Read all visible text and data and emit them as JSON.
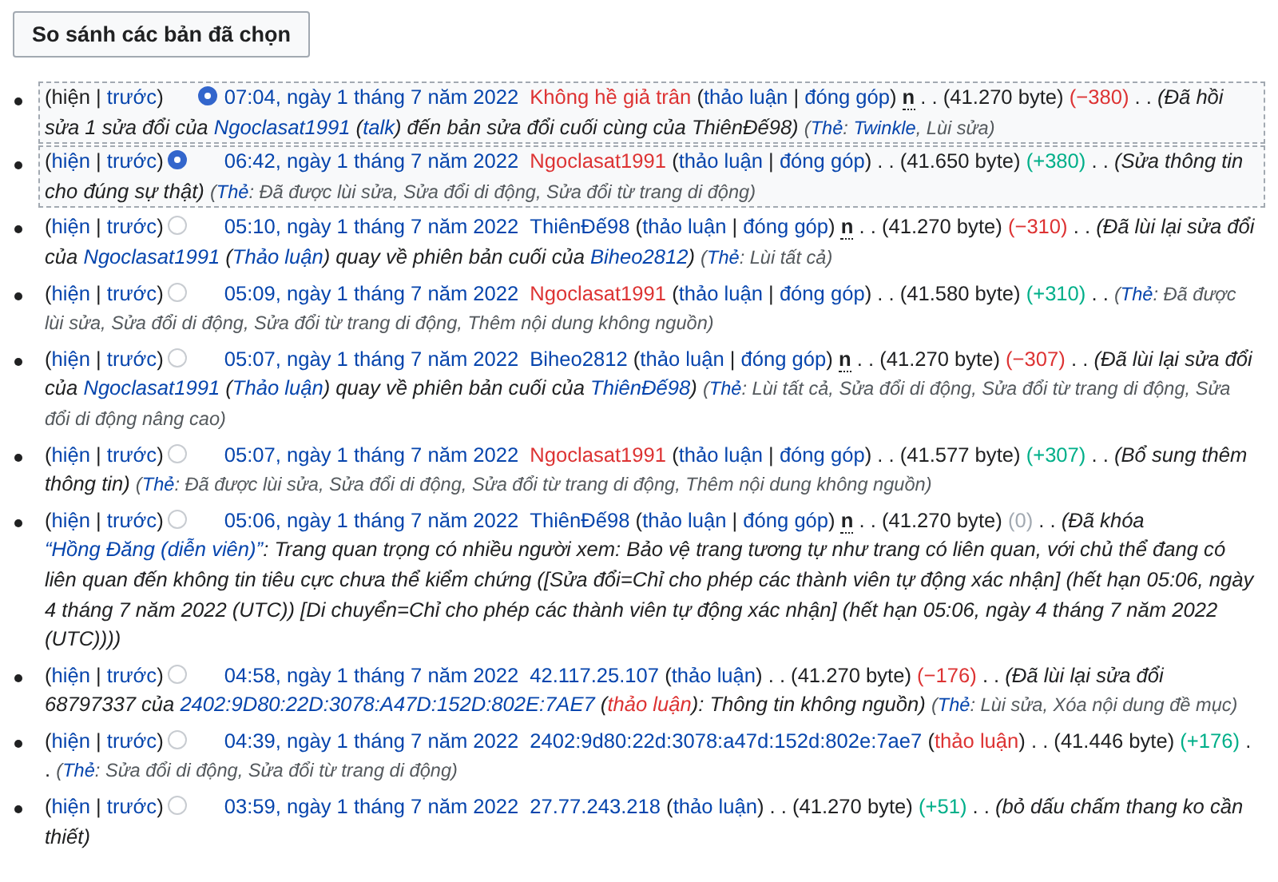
{
  "compare_button": "So sánh các bản đã chọn",
  "entries": [
    {
      "radio": {
        "kind": "diff",
        "selected": true
      },
      "head": [
        {
          "kind": "text",
          "text": "(hiện | "
        },
        {
          "kind": "link",
          "text": "trước"
        },
        {
          "kind": "text",
          "text": ")"
        }
      ],
      "body": [
        {
          "kind": "time",
          "text": "07:04, ngày 1 tháng 7 năm 2022"
        },
        {
          "kind": "red",
          "text": "Không hề giả trân"
        },
        {
          "kind": "text",
          "text": " ("
        },
        {
          "kind": "link",
          "text": "thảo luận"
        },
        {
          "kind": "text",
          "text": " | "
        },
        {
          "kind": "link",
          "text": "đóng góp"
        },
        {
          "kind": "text",
          "text": ") "
        },
        {
          "kind": "minor",
          "text": "n"
        },
        {
          "kind": "text",
          "text": " . . (41.270 byte) "
        },
        {
          "kind": "neg",
          "text": "(−380)"
        },
        {
          "kind": "text",
          "text": " . . "
        },
        {
          "kind": "sum",
          "text": "(Đã hồi sửa 1 sửa đổi của "
        },
        {
          "kind": "sumlink",
          "text": "Ngoclasat1991"
        },
        {
          "kind": "sum",
          "text": " ("
        },
        {
          "kind": "sumlink",
          "text": "talk"
        },
        {
          "kind": "sum",
          "text": ") đến bản sửa đổi cuối cùng của ThiênĐế98) "
        },
        {
          "kind": "tag",
          "text": "("
        },
        {
          "kind": "taglink",
          "text": "Thẻ"
        },
        {
          "kind": "tag",
          "text": ": "
        },
        {
          "kind": "taglink",
          "text": "Twinkle"
        },
        {
          "kind": "tag",
          "text": ", Lùi sửa)"
        }
      ]
    },
    {
      "radio": {
        "kind": "oldid",
        "selected": true
      },
      "head": [
        {
          "kind": "text",
          "text": "("
        },
        {
          "kind": "link",
          "text": "hiện"
        },
        {
          "kind": "text",
          "text": " | "
        },
        {
          "kind": "link",
          "text": "trước"
        },
        {
          "kind": "text",
          "text": ")"
        }
      ],
      "body": [
        {
          "kind": "time",
          "text": "06:42, ngày 1 tháng 7 năm 2022"
        },
        {
          "kind": "red",
          "text": "Ngoclasat1991"
        },
        {
          "kind": "text",
          "text": " ("
        },
        {
          "kind": "link",
          "text": "thảo luận"
        },
        {
          "kind": "text",
          "text": " | "
        },
        {
          "kind": "link",
          "text": "đóng góp"
        },
        {
          "kind": "text",
          "text": ") . . (41.650 byte) "
        },
        {
          "kind": "pos",
          "text": "(+380)"
        },
        {
          "kind": "text",
          "text": " . . "
        },
        {
          "kind": "sum",
          "text": "(Sửa thông tin cho đúng sự thật) "
        },
        {
          "kind": "tag",
          "text": "("
        },
        {
          "kind": "taglink",
          "text": "Thẻ"
        },
        {
          "kind": "tag",
          "text": ": Đã được lùi sửa, Sửa đổi di động, Sửa đổi từ trang di động)"
        }
      ]
    },
    {
      "radio": {
        "kind": "oldid",
        "selected": false
      },
      "head": [
        {
          "kind": "text",
          "text": "("
        },
        {
          "kind": "link",
          "text": "hiện"
        },
        {
          "kind": "text",
          "text": " | "
        },
        {
          "kind": "link",
          "text": "trước"
        },
        {
          "kind": "text",
          "text": ")"
        }
      ],
      "body": [
        {
          "kind": "time",
          "text": "05:10, ngày 1 tháng 7 năm 2022"
        },
        {
          "kind": "link",
          "text": "ThiênĐế98"
        },
        {
          "kind": "text",
          "text": " ("
        },
        {
          "kind": "link",
          "text": "thảo luận"
        },
        {
          "kind": "text",
          "text": " | "
        },
        {
          "kind": "link",
          "text": "đóng góp"
        },
        {
          "kind": "text",
          "text": ") "
        },
        {
          "kind": "minor",
          "text": "n"
        },
        {
          "kind": "text",
          "text": " . . (41.270 byte) "
        },
        {
          "kind": "neg",
          "text": "(−310)"
        },
        {
          "kind": "text",
          "text": " . . "
        },
        {
          "kind": "sum",
          "text": "(Đã lùi lại sửa đổi của "
        },
        {
          "kind": "sumlink",
          "text": "Ngoclasat1991"
        },
        {
          "kind": "sum",
          "text": " ("
        },
        {
          "kind": "sumlink",
          "text": "Thảo luận"
        },
        {
          "kind": "sum",
          "text": ") quay về phiên bản cuối của "
        },
        {
          "kind": "sumlink",
          "text": "Biheo2812"
        },
        {
          "kind": "sum",
          "text": ") "
        },
        {
          "kind": "tag",
          "text": "("
        },
        {
          "kind": "taglink",
          "text": "Thẻ"
        },
        {
          "kind": "tag",
          "text": ": Lùi tất cả)"
        }
      ]
    },
    {
      "radio": {
        "kind": "oldid",
        "selected": false
      },
      "head": [
        {
          "kind": "text",
          "text": "("
        },
        {
          "kind": "link",
          "text": "hiện"
        },
        {
          "kind": "text",
          "text": " | "
        },
        {
          "kind": "link",
          "text": "trước"
        },
        {
          "kind": "text",
          "text": ")"
        }
      ],
      "body": [
        {
          "kind": "time",
          "text": "05:09, ngày 1 tháng 7 năm 2022"
        },
        {
          "kind": "red",
          "text": "Ngoclasat1991"
        },
        {
          "kind": "text",
          "text": " ("
        },
        {
          "kind": "link",
          "text": "thảo luận"
        },
        {
          "kind": "text",
          "text": " | "
        },
        {
          "kind": "link",
          "text": "đóng góp"
        },
        {
          "kind": "text",
          "text": ") . . (41.580 byte) "
        },
        {
          "kind": "pos",
          "text": "(+310)"
        },
        {
          "kind": "text",
          "text": " . . "
        },
        {
          "kind": "tag",
          "text": "("
        },
        {
          "kind": "taglink",
          "text": "Thẻ"
        },
        {
          "kind": "tag",
          "text": ": Đã được lùi sửa, Sửa đổi di động, Sửa đổi từ trang di động, Thêm nội dung không nguồn)"
        }
      ]
    },
    {
      "radio": {
        "kind": "oldid",
        "selected": false
      },
      "head": [
        {
          "kind": "text",
          "text": "("
        },
        {
          "kind": "link",
          "text": "hiện"
        },
        {
          "kind": "text",
          "text": " | "
        },
        {
          "kind": "link",
          "text": "trước"
        },
        {
          "kind": "text",
          "text": ")"
        }
      ],
      "body": [
        {
          "kind": "time",
          "text": "05:07, ngày 1 tháng 7 năm 2022"
        },
        {
          "kind": "link",
          "text": "Biheo2812"
        },
        {
          "kind": "text",
          "text": " ("
        },
        {
          "kind": "link",
          "text": "thảo luận"
        },
        {
          "kind": "text",
          "text": " | "
        },
        {
          "kind": "link",
          "text": "đóng góp"
        },
        {
          "kind": "text",
          "text": ") "
        },
        {
          "kind": "minor",
          "text": "n"
        },
        {
          "kind": "text",
          "text": " . . (41.270 byte) "
        },
        {
          "kind": "neg",
          "text": "(−307)"
        },
        {
          "kind": "text",
          "text": " . . "
        },
        {
          "kind": "sum",
          "text": "(Đã lùi lại sửa đổi của "
        },
        {
          "kind": "sumlink",
          "text": "Ngoclasat1991"
        },
        {
          "kind": "sum",
          "text": " ("
        },
        {
          "kind": "sumlink",
          "text": "Thảo luận"
        },
        {
          "kind": "sum",
          "text": ") quay về phiên bản cuối của "
        },
        {
          "kind": "sumlink",
          "text": "ThiênĐế98"
        },
        {
          "kind": "sum",
          "text": ") "
        },
        {
          "kind": "tag",
          "text": "("
        },
        {
          "kind": "taglink",
          "text": "Thẻ"
        },
        {
          "kind": "tag",
          "text": ": Lùi tất cả, Sửa đổi di động, Sửa đổi từ trang di động, Sửa đổi di động nâng cao)"
        }
      ]
    },
    {
      "radio": {
        "kind": "oldid",
        "selected": false
      },
      "head": [
        {
          "kind": "text",
          "text": "("
        },
        {
          "kind": "link",
          "text": "hiện"
        },
        {
          "kind": "text",
          "text": " | "
        },
        {
          "kind": "link",
          "text": "trước"
        },
        {
          "kind": "text",
          "text": ")"
        }
      ],
      "body": [
        {
          "kind": "time",
          "text": "05:07, ngày 1 tháng 7 năm 2022"
        },
        {
          "kind": "red",
          "text": "Ngoclasat1991"
        },
        {
          "kind": "text",
          "text": " ("
        },
        {
          "kind": "link",
          "text": "thảo luận"
        },
        {
          "kind": "text",
          "text": " | "
        },
        {
          "kind": "link",
          "text": "đóng góp"
        },
        {
          "kind": "text",
          "text": ") . . (41.577 byte) "
        },
        {
          "kind": "pos",
          "text": "(+307)"
        },
        {
          "kind": "text",
          "text": " . . "
        },
        {
          "kind": "sum",
          "text": "(Bổ sung thêm thông tin) "
        },
        {
          "kind": "tag",
          "text": "("
        },
        {
          "kind": "taglink",
          "text": "Thẻ"
        },
        {
          "kind": "tag",
          "text": ": Đã được lùi sửa, Sửa đổi di động, Sửa đổi từ trang di động, Thêm nội dung không nguồn)"
        }
      ]
    },
    {
      "radio": {
        "kind": "oldid",
        "selected": false
      },
      "head": [
        {
          "kind": "text",
          "text": "("
        },
        {
          "kind": "link",
          "text": "hiện"
        },
        {
          "kind": "text",
          "text": " | "
        },
        {
          "kind": "link",
          "text": "trước"
        },
        {
          "kind": "text",
          "text": ")"
        }
      ],
      "body": [
        {
          "kind": "time",
          "text": "05:06, ngày 1 tháng 7 năm 2022"
        },
        {
          "kind": "link",
          "text": "ThiênĐế98"
        },
        {
          "kind": "text",
          "text": " ("
        },
        {
          "kind": "link",
          "text": "thảo luận"
        },
        {
          "kind": "text",
          "text": " | "
        },
        {
          "kind": "link",
          "text": "đóng góp"
        },
        {
          "kind": "text",
          "text": ") "
        },
        {
          "kind": "minor",
          "text": "n"
        },
        {
          "kind": "text",
          "text": " . . (41.270 byte) "
        },
        {
          "kind": "zero",
          "text": "(0)"
        },
        {
          "kind": "text",
          "text": " . . "
        },
        {
          "kind": "sum",
          "text": "(Đã khóa "
        },
        {
          "kind": "sumlink",
          "text": "“Hồng Đăng (diễn viên)”"
        },
        {
          "kind": "sum",
          "text": ": Trang quan trọng có nhiều người xem: Bảo vệ trang tương tự như trang có liên quan, với chủ thể đang có liên quan đến không tin tiêu cực chưa thể kiểm chứng ([Sửa đổi=Chỉ cho phép các thành viên tự động xác nhận] (hết hạn 05:06, ngày 4 tháng 7 năm 2022 (UTC)) [Di chuyển=Chỉ cho phép các thành viên tự động xác nhận] (hết hạn 05:06, ngày 4 tháng 7 năm 2022 (UTC))))"
        }
      ]
    },
    {
      "radio": {
        "kind": "oldid",
        "selected": false
      },
      "head": [
        {
          "kind": "text",
          "text": "("
        },
        {
          "kind": "link",
          "text": "hiện"
        },
        {
          "kind": "text",
          "text": " | "
        },
        {
          "kind": "link",
          "text": "trước"
        },
        {
          "kind": "text",
          "text": ")"
        }
      ],
      "body": [
        {
          "kind": "time",
          "text": "04:58, ngày 1 tháng 7 năm 2022"
        },
        {
          "kind": "link",
          "text": "42.117.25.107"
        },
        {
          "kind": "text",
          "text": " ("
        },
        {
          "kind": "link",
          "text": "thảo luận"
        },
        {
          "kind": "text",
          "text": ") . . (41.270 byte) "
        },
        {
          "kind": "neg",
          "text": "(−176)"
        },
        {
          "kind": "text",
          "text": " . . "
        },
        {
          "kind": "sum",
          "text": "(Đã lùi lại sửa đổi 68797337 của "
        },
        {
          "kind": "sumlink",
          "text": "2402:9D80:22D:3078:A47D:152D:802E:7AE7"
        },
        {
          "kind": "sum",
          "text": " ("
        },
        {
          "kind": "sumred",
          "text": "thảo luận"
        },
        {
          "kind": "sum",
          "text": "): Thông tin không nguồn) "
        },
        {
          "kind": "tag",
          "text": "("
        },
        {
          "kind": "taglink",
          "text": "Thẻ"
        },
        {
          "kind": "tag",
          "text": ": Lùi sửa, Xóa nội dung đề mục)"
        }
      ]
    },
    {
      "radio": {
        "kind": "oldid",
        "selected": false
      },
      "head": [
        {
          "kind": "text",
          "text": "("
        },
        {
          "kind": "link",
          "text": "hiện"
        },
        {
          "kind": "text",
          "text": " | "
        },
        {
          "kind": "link",
          "text": "trước"
        },
        {
          "kind": "text",
          "text": ")"
        }
      ],
      "body": [
        {
          "kind": "time",
          "text": "04:39, ngày 1 tháng 7 năm 2022"
        },
        {
          "kind": "link",
          "text": "2402:9d80:22d:3078:a47d:152d:802e:7ae7"
        },
        {
          "kind": "text",
          "text": " ("
        },
        {
          "kind": "red",
          "text": "thảo luận"
        },
        {
          "kind": "text",
          "text": ") . . (41.446 byte) "
        },
        {
          "kind": "pos",
          "text": "(+176)"
        },
        {
          "kind": "text",
          "text": " . . "
        },
        {
          "kind": "tag",
          "text": "("
        },
        {
          "kind": "taglink",
          "text": "Thẻ"
        },
        {
          "kind": "tag",
          "text": ": Sửa đổi di động, Sửa đổi từ trang di động)"
        }
      ]
    },
    {
      "radio": {
        "kind": "oldid",
        "selected": false
      },
      "head": [
        {
          "kind": "text",
          "text": "("
        },
        {
          "kind": "link",
          "text": "hiện"
        },
        {
          "kind": "text",
          "text": " | "
        },
        {
          "kind": "link",
          "text": "trước"
        },
        {
          "kind": "text",
          "text": ")"
        }
      ],
      "body": [
        {
          "kind": "time",
          "text": "03:59, ngày 1 tháng 7 năm 2022"
        },
        {
          "kind": "link",
          "text": "27.77.243.218"
        },
        {
          "kind": "text",
          "text": " ("
        },
        {
          "kind": "link",
          "text": "thảo luận"
        },
        {
          "kind": "text",
          "text": ") . . (41.270 byte) "
        },
        {
          "kind": "pos",
          "text": "(+51)"
        },
        {
          "kind": "text",
          "text": " . . "
        },
        {
          "kind": "sum",
          "text": "(bỏ dấu chấm thang ko cần thiết)"
        }
      ]
    }
  ]
}
